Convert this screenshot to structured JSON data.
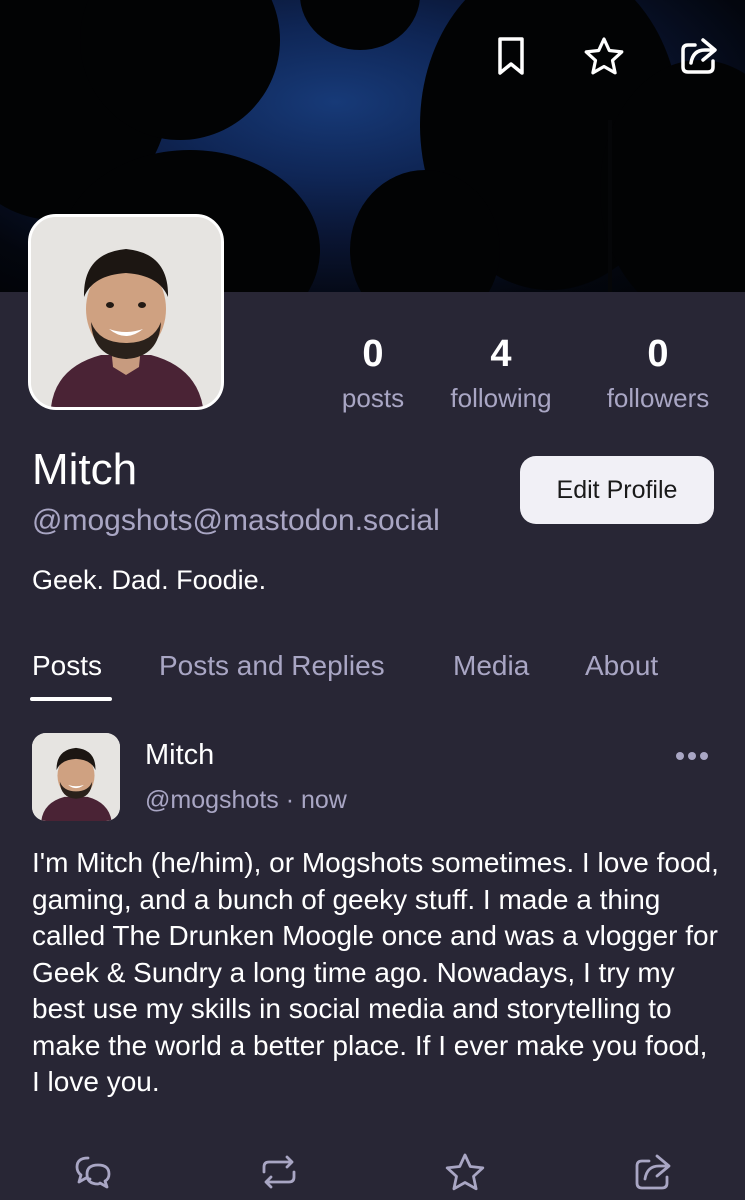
{
  "header": {
    "icons": [
      "bookmark-icon",
      "star-icon",
      "share-icon"
    ]
  },
  "profile": {
    "display_name": "Mitch",
    "handle": "@mogshots@mastodon.social",
    "bio": "Geek. Dad. Foodie.",
    "edit_button_label": "Edit Profile",
    "stats": {
      "posts": {
        "value": "0",
        "label": "posts"
      },
      "following": {
        "value": "4",
        "label": "following"
      },
      "followers": {
        "value": "0",
        "label": "followers"
      }
    }
  },
  "tabs": [
    {
      "label": "Posts",
      "active": true
    },
    {
      "label": "Posts and Replies",
      "active": false
    },
    {
      "label": "Media",
      "active": false
    },
    {
      "label": "About",
      "active": false
    }
  ],
  "post": {
    "author": "Mitch",
    "handle": "@mogshots",
    "separator": "·",
    "time": "now",
    "text": "I'm Mitch (he/him), or Mogshots sometimes. I love food, gaming, and a bunch of geeky stuff. I made a thing called The Drunken Moogle once and was a vlogger for Geek & Sundry a long time ago. Nowadays, I try my best use my skills in social media and storytelling to make the world a better place. If I ever make you food, I love you.",
    "actions": [
      "reply-icon",
      "boost-icon",
      "favorite-icon",
      "share-icon"
    ]
  },
  "colors": {
    "background": "#282635",
    "muted_text": "#a9a6c4",
    "button_bg": "#f1f0f6"
  }
}
